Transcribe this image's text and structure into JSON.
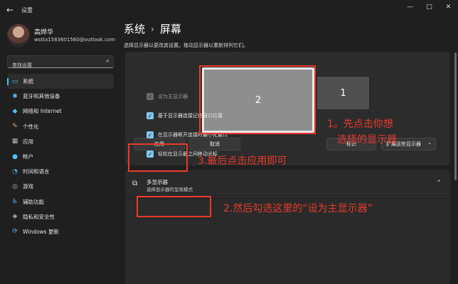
{
  "window": {
    "title": "设置",
    "back_icon": "←",
    "controls": [
      "—",
      "□",
      "✕"
    ]
  },
  "profile": {
    "name": "高烨华",
    "email": "wstta1583601560@outlook.com"
  },
  "search": {
    "placeholder": "查找设置",
    "icon": "⌕"
  },
  "nav": {
    "items": [
      {
        "label": "系统",
        "icon": "▭",
        "icon_name": "system-icon",
        "active": true,
        "color": "#4cc2ff"
      },
      {
        "label": "蓝牙和其他设备",
        "icon": "✱",
        "icon_name": "bluetooth-icon",
        "active": false,
        "color": "#4cc2ff"
      },
      {
        "label": "网络和 Internet",
        "icon": "◆",
        "icon_name": "network-icon",
        "active": false,
        "color": "#4cc2ff"
      },
      {
        "label": "个性化",
        "icon": "✎",
        "icon_name": "personalization-icon",
        "active": false,
        "color": "#e8a87c"
      },
      {
        "label": "应用",
        "icon": "▦",
        "icon_name": "apps-icon",
        "active": false,
        "color": "#bbbbbb"
      },
      {
        "label": "帐户",
        "icon": "●",
        "icon_name": "accounts-icon",
        "active": false,
        "color": "#4cc2ff"
      },
      {
        "label": "时间和语言",
        "icon": "◔",
        "icon_name": "time-language-icon",
        "active": false,
        "color": "#4cc2ff"
      },
      {
        "label": "游戏",
        "icon": "◎",
        "icon_name": "gaming-icon",
        "active": false,
        "color": "#bbbbbb"
      },
      {
        "label": "辅助功能",
        "icon": "♿",
        "icon_name": "accessibility-icon",
        "active": false,
        "color": "#4cc2ff"
      },
      {
        "label": "隐私和安全性",
        "icon": "◈",
        "icon_name": "privacy-icon",
        "active": false,
        "color": "#bbbbbb"
      },
      {
        "label": "Windows 更新",
        "icon": "⟳",
        "icon_name": "windows-update-icon",
        "active": false,
        "color": "#4cc2ff"
      }
    ]
  },
  "page": {
    "crumb_parent": "系统",
    "crumb_sep": "›",
    "crumb_current": "屏幕",
    "description": "选择显示器以更改其设置。拖动显示器以重新排列它们。"
  },
  "displays": {
    "primary_label": "2",
    "secondary_label": "1",
    "apply_button": "应用",
    "cancel_button": "取消",
    "identify_button": "标识",
    "extend_dropdown": "扩展这些显示器",
    "dropdown_chevron": "⌄"
  },
  "multi_display": {
    "title": "多显示器",
    "subtitle": "选择显示器的呈现模式",
    "chevron": "⌃",
    "options": [
      {
        "label": "设为主显示器",
        "checked": true,
        "disabled": true
      },
      {
        "label": "基于显示器连接记住窗口位置",
        "checked": true,
        "disabled": false
      },
      {
        "label": "在显示器断开连接时最小化窗口",
        "checked": true,
        "disabled": false
      },
      {
        "label": "轻松在显示器之间移动光标",
        "checked": true,
        "disabled": false
      }
    ]
  },
  "annotations": {
    "step1_line1": "1。先点击你想",
    "step1_line2": "选择的显示器",
    "step2": "2.然后勾选这里的“设为主显示器”",
    "step3": "3.最后点击应用即可",
    "color": "#e8392b"
  }
}
